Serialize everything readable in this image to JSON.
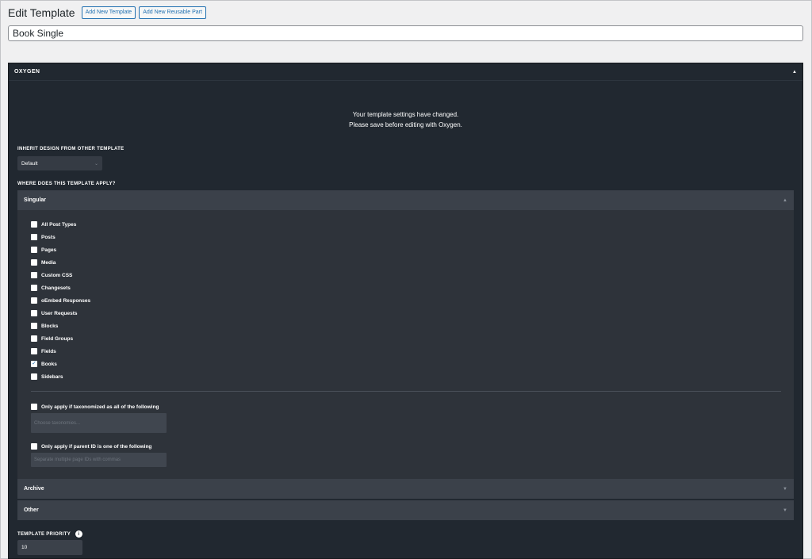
{
  "header": {
    "title": "Edit Template",
    "add_template_label": "Add New Template",
    "add_part_label": "Add New Reusable Part"
  },
  "title_input": {
    "value": "Book Single"
  },
  "metabox": {
    "title": "OXYGEN",
    "collapse_icon": "triangle-up-icon",
    "notice_line1": "Your template settings have changed.",
    "notice_line2": "Please save before editing with Oxygen.",
    "inherit_label": "INHERIT DESIGN FROM OTHER TEMPLATE",
    "inherit_value": "Default",
    "where_label": "WHERE DOES THIS TEMPLATE APPLY?",
    "singular": {
      "title": "Singular",
      "post_types": [
        {
          "label": "All Post Types",
          "checked": false
        },
        {
          "label": "Posts",
          "checked": false
        },
        {
          "label": "Pages",
          "checked": false
        },
        {
          "label": "Media",
          "checked": false
        },
        {
          "label": "Custom CSS",
          "checked": false
        },
        {
          "label": "Changesets",
          "checked": false
        },
        {
          "label": "oEmbed Responses",
          "checked": false
        },
        {
          "label": "User Requests",
          "checked": false
        },
        {
          "label": "Blocks",
          "checked": false
        },
        {
          "label": "Field Groups",
          "checked": false
        },
        {
          "label": "Fields",
          "checked": false
        },
        {
          "label": "Books",
          "checked": true
        },
        {
          "label": "Sidebars",
          "checked": false
        }
      ],
      "taxonomy_label": "Only apply if taxonomized as all of the following",
      "taxonomy_placeholder": "Choose taxonomies...",
      "parent_label": "Only apply if parent ID is one of the following",
      "parent_placeholder": "Separate multiple page IDs with commas"
    },
    "archive_title": "Archive",
    "other_title": "Other",
    "priority_label": "TEMPLATE PRIORITY",
    "priority_info": "i",
    "priority_value": "10"
  }
}
